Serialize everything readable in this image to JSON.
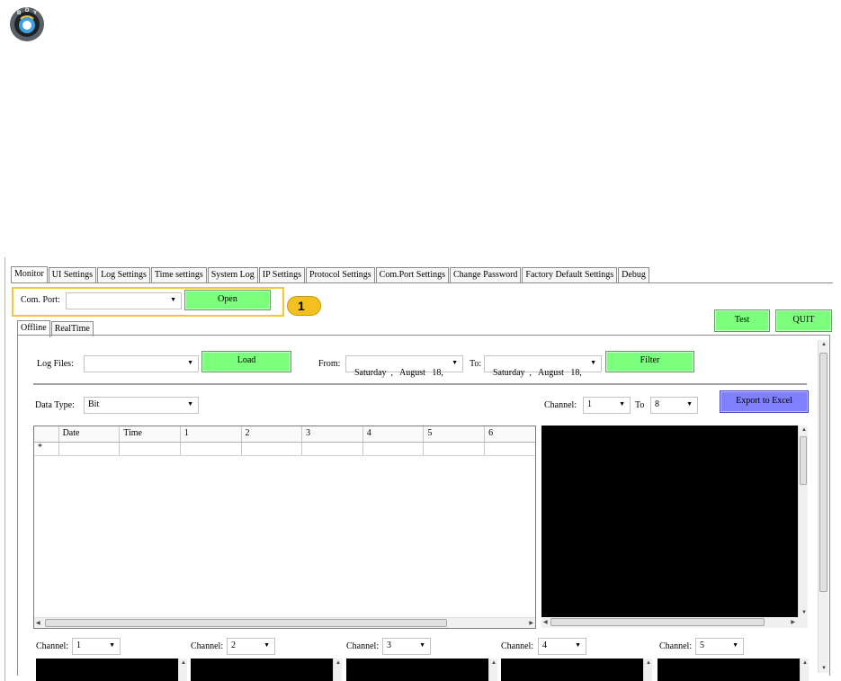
{
  "logo": {
    "letters": "B D Y",
    "icon": "globe-logo-icon"
  },
  "main_tabs": [
    "Monitor",
    "UI Settings",
    "Log Settings",
    "Time settings",
    "System Log",
    "IP Settings",
    "Protocol Settings",
    "Com.Port Settings",
    "Change Password",
    "Factory Default Settings",
    "Debug"
  ],
  "com_port": {
    "label": "Com. Port:",
    "value": "",
    "open_label": "Open"
  },
  "callout": {
    "number": "1"
  },
  "top_buttons": {
    "test": "Test",
    "quit": "QUIT"
  },
  "sub_tabs": [
    "Offline",
    "RealTime"
  ],
  "log_files": {
    "label": "Log Files:",
    "value": "",
    "load_label": "Load"
  },
  "date_filter": {
    "from_label": "From:",
    "from_value": "Saturday  ,   August   18, ",
    "to_label": "To:",
    "to_value": "Saturday  ,   August   18, ",
    "filter_label": "Filter"
  },
  "data_type": {
    "label": "Data Type:",
    "value": "Bit"
  },
  "channel_range": {
    "label": "Channel:",
    "from": "1",
    "to_label": "To",
    "to": "8",
    "export_label": "Export to Excel"
  },
  "grid": {
    "columns": [
      "Date",
      "Time",
      "1",
      "2",
      "3",
      "4",
      "5",
      "6"
    ],
    "new_row_marker": "*"
  },
  "channels": [
    {
      "label": "Channel:",
      "value": "1"
    },
    {
      "label": "Channel:",
      "value": "2"
    },
    {
      "label": "Channel:",
      "value": "3"
    },
    {
      "label": "Channel:",
      "value": "4"
    },
    {
      "label": "Channel:",
      "value": "5"
    }
  ],
  "colors": {
    "green_button": "#7cff7c",
    "blue_button": "#8080ff",
    "callout": "#f4c020",
    "terminal": "#000000"
  }
}
